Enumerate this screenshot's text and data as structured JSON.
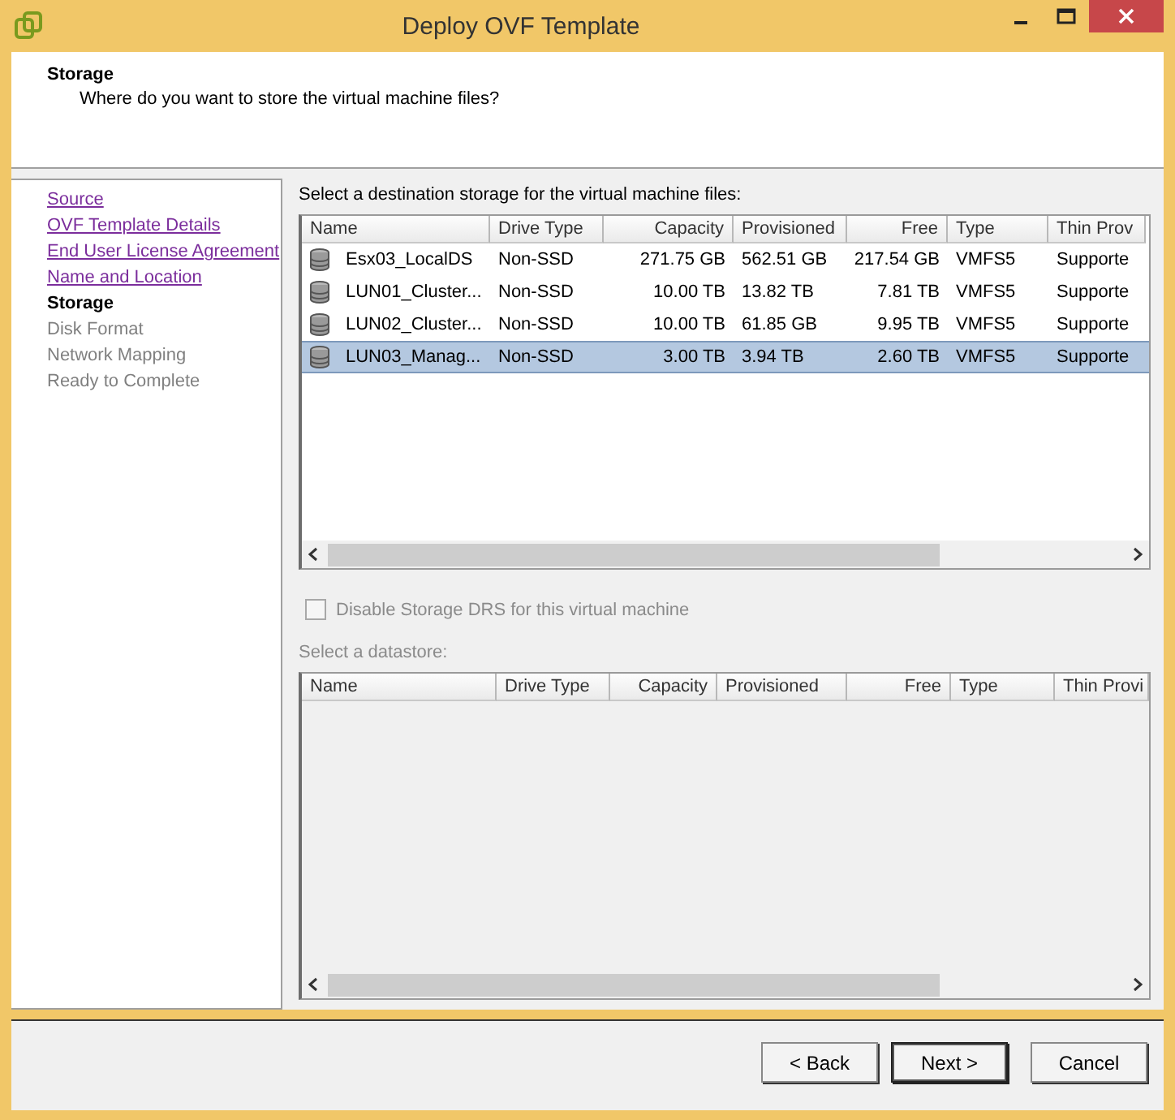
{
  "window": {
    "title": "Deploy OVF Template"
  },
  "header": {
    "title": "Storage",
    "subtitle": "Where do you want to store the virtual machine files?"
  },
  "steps": [
    {
      "label": "Source",
      "kind": "done"
    },
    {
      "label": "OVF Template Details",
      "kind": "done"
    },
    {
      "label": "End User License Agreement",
      "kind": "done"
    },
    {
      "label": "Name and Location",
      "kind": "done"
    },
    {
      "label": "Storage",
      "kind": "current"
    },
    {
      "label": "Disk Format",
      "kind": "pending"
    },
    {
      "label": "Network Mapping",
      "kind": "pending"
    },
    {
      "label": "Ready to Complete",
      "kind": "pending"
    }
  ],
  "storage_table": {
    "caption": "Select a destination storage for the virtual machine files:",
    "columns": [
      "Name",
      "Drive Type",
      "Capacity",
      "Provisioned",
      "Free",
      "Type",
      "Thin Prov"
    ],
    "rows": [
      {
        "selected": false,
        "cells": [
          "Esx03_LocalDS",
          "Non-SSD",
          "271.75 GB",
          "562.51 GB",
          "217.54 GB",
          "VMFS5",
          "Supporte"
        ]
      },
      {
        "selected": false,
        "cells": [
          "LUN01_Cluster...",
          "Non-SSD",
          "10.00 TB",
          "13.82 TB",
          "7.81 TB",
          "VMFS5",
          "Supporte"
        ]
      },
      {
        "selected": false,
        "cells": [
          "LUN02_Cluster...",
          "Non-SSD",
          "10.00 TB",
          "61.85 GB",
          "9.95 TB",
          "VMFS5",
          "Supporte"
        ]
      },
      {
        "selected": true,
        "cells": [
          "LUN03_Manag...",
          "Non-SSD",
          "3.00 TB",
          "3.94 TB",
          "2.60 TB",
          "VMFS5",
          "Supporte"
        ]
      }
    ]
  },
  "drs_option": {
    "label": "Disable Storage DRS for this virtual machine",
    "checked": false,
    "disabled": true
  },
  "datastore_table": {
    "caption": "Select a datastore:",
    "columns": [
      "Name",
      "Drive Type",
      "Capacity",
      "Provisioned",
      "Free",
      "Type",
      "Thin Provi"
    ]
  },
  "buttons": [
    {
      "label": "< Back",
      "default": false
    },
    {
      "label": "Next >",
      "default": true
    },
    {
      "label": "Cancel",
      "default": false
    }
  ]
}
